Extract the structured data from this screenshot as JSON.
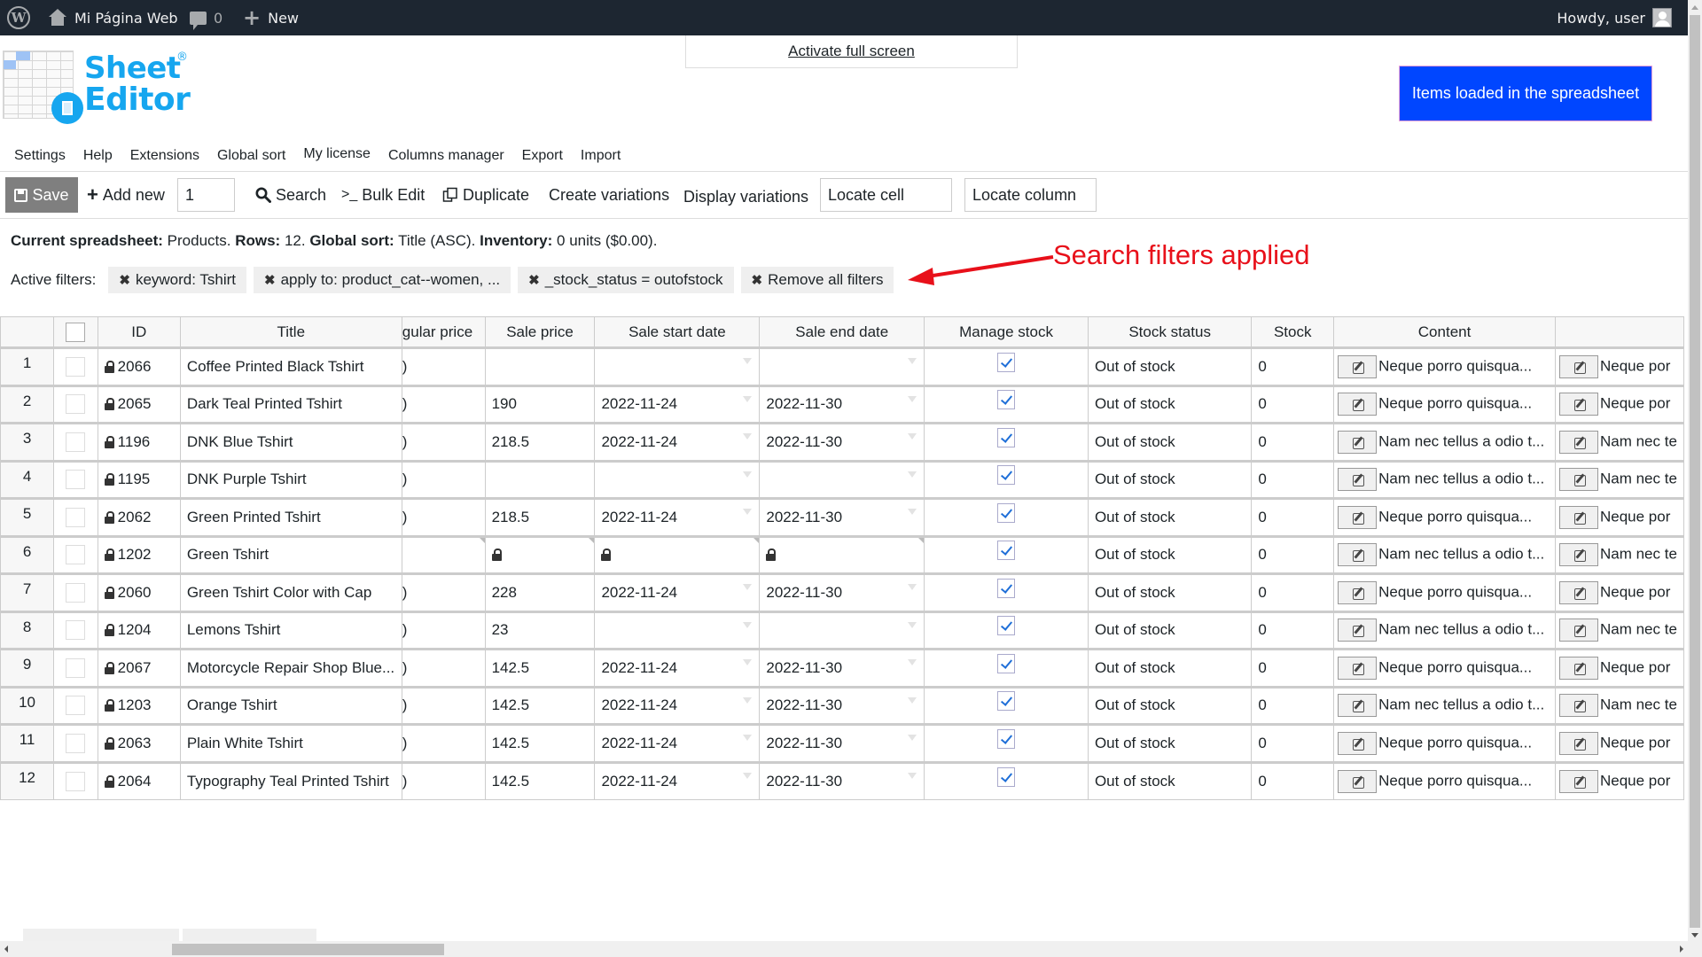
{
  "adminbar": {
    "site_name": "Mi Página Web",
    "comments_count": "0",
    "new_label": "New",
    "howdy": "Howdy, user"
  },
  "logo": {
    "line1": "Sheet",
    "line2": "Editor",
    "reg": "®"
  },
  "fullscreen_link": "Activate full screen",
  "items_loaded_button": "Items loaded in the spreadsheet",
  "menu": [
    "Settings",
    "Help",
    "Extensions",
    "Global sort",
    "My license",
    "Columns manager",
    "Export",
    "Import"
  ],
  "toolbar": {
    "save": "Save",
    "add_new": "Add new",
    "add_new_qty": "1",
    "search": "Search",
    "bulk_edit": "Bulk Edit",
    "bulk_edit_prefix": ">_",
    "duplicate": "Duplicate",
    "create_variations": "Create variations",
    "display_variations": "Display variations",
    "locate_cell_placeholder": "Locate cell",
    "locate_column_placeholder": "Locate column"
  },
  "info": {
    "spreadsheet_label": "Current spreadsheet:",
    "spreadsheet_value": "Products.",
    "rows_label": "Rows:",
    "rows_value": "12.",
    "sort_label": "Global sort:",
    "sort_value": "Title (ASC).",
    "inventory_label": "Inventory:",
    "inventory_value": "0 units ($0.00)."
  },
  "filters": {
    "label": "Active filters:",
    "chips": [
      "keyword: Tshirt",
      "apply to: product_cat--women, ...",
      "_stock_status = outofstock",
      "Remove all filters"
    ]
  },
  "annotation": {
    "text": "Search filters applied",
    "color": "#e8101a"
  },
  "colors": {
    "accent_blue": "#0046ff",
    "logo_blue": "#16a6ef",
    "adminbar": "#1d2631",
    "save_button": "#7f7f7f"
  },
  "table": {
    "headers": [
      "",
      "",
      "ID",
      "Title",
      "gular price",
      "Sale price",
      "Sale start date",
      "Sale end date",
      "Manage stock",
      "Stock status",
      "Stock",
      "Content",
      ""
    ],
    "rows": [
      {
        "num": "1",
        "id": "2066",
        "title": "Coffee Printed Black Tshirt",
        "reg": ")",
        "sale": "",
        "start": "",
        "end": "",
        "manage": true,
        "status": "Out of stock",
        "stock": "0",
        "content": "Neque porro quisqua...",
        "extra": "Neque por"
      },
      {
        "num": "2",
        "id": "2065",
        "title": "Dark Teal Printed Tshirt",
        "reg": ")",
        "sale": "190",
        "start": "2022-11-24",
        "end": "2022-11-30",
        "manage": true,
        "status": "Out of stock",
        "stock": "0",
        "content": "Neque porro quisqua...",
        "extra": "Neque por"
      },
      {
        "num": "3",
        "id": "1196",
        "title": "DNK Blue Tshirt",
        "reg": ")",
        "sale": "218.5",
        "start": "2022-11-24",
        "end": "2022-11-30",
        "manage": true,
        "status": "Out of stock",
        "stock": "0",
        "content": "Nam nec tellus a odio t...",
        "extra": "Nam nec te"
      },
      {
        "num": "4",
        "id": "1195",
        "title": "DNK Purple Tshirt",
        "reg": ")",
        "sale": "",
        "start": "",
        "end": "",
        "manage": true,
        "status": "Out of stock",
        "stock": "0",
        "content": "Nam nec tellus a odio t...",
        "extra": "Nam nec te"
      },
      {
        "num": "5",
        "id": "2062",
        "title": "Green Printed Tshirt",
        "reg": ")",
        "sale": "218.5",
        "start": "2022-11-24",
        "end": "2022-11-30",
        "manage": true,
        "status": "Out of stock",
        "stock": "0",
        "content": "Neque porro quisqua...",
        "extra": "Neque por"
      },
      {
        "num": "6",
        "id": "1202",
        "title": "Green Tshirt",
        "reg": "",
        "sale": "",
        "start": "",
        "end": "",
        "locked": true,
        "manage": true,
        "status": "Out of stock",
        "stock": "0",
        "content": "Nam nec tellus a odio t...",
        "extra": "Nam nec te"
      },
      {
        "num": "7",
        "id": "2060",
        "title": "Green Tshirt Color with Cap",
        "reg": ")",
        "sale": "228",
        "start": "2022-11-24",
        "end": "2022-11-30",
        "manage": true,
        "status": "Out of stock",
        "stock": "0",
        "content": "Neque porro quisqua...",
        "extra": "Neque por"
      },
      {
        "num": "8",
        "id": "1204",
        "title": "Lemons Tshirt",
        "reg": ")",
        "sale": "23",
        "start": "",
        "end": "",
        "manage": true,
        "status": "Out of stock",
        "stock": "0",
        "content": "Nam nec tellus a odio t...",
        "extra": "Nam nec te"
      },
      {
        "num": "9",
        "id": "2067",
        "title": "Motorcycle Repair Shop Blue...",
        "reg": ")",
        "sale": "142.5",
        "start": "2022-11-24",
        "end": "2022-11-30",
        "manage": true,
        "status": "Out of stock",
        "stock": "0",
        "content": "Neque porro quisqua...",
        "extra": "Neque por"
      },
      {
        "num": "10",
        "id": "1203",
        "title": "Orange Tshirt",
        "reg": ")",
        "sale": "142.5",
        "start": "2022-11-24",
        "end": "2022-11-30",
        "manage": true,
        "status": "Out of stock",
        "stock": "0",
        "content": "Nam nec tellus a odio t...",
        "extra": "Nam nec te"
      },
      {
        "num": "11",
        "id": "2063",
        "title": "Plain White Tshirt",
        "reg": ")",
        "sale": "142.5",
        "start": "2022-11-24",
        "end": "2022-11-30",
        "manage": true,
        "status": "Out of stock",
        "stock": "0",
        "content": "Neque porro quisqua...",
        "extra": "Neque por"
      },
      {
        "num": "12",
        "id": "2064",
        "title": "Typography Teal Printed Tshirt",
        "reg": ")",
        "sale": "142.5",
        "start": "2022-11-24",
        "end": "2022-11-30",
        "manage": true,
        "status": "Out of stock",
        "stock": "0",
        "content": "Neque porro quisqua...",
        "extra": "Neque por"
      }
    ]
  }
}
